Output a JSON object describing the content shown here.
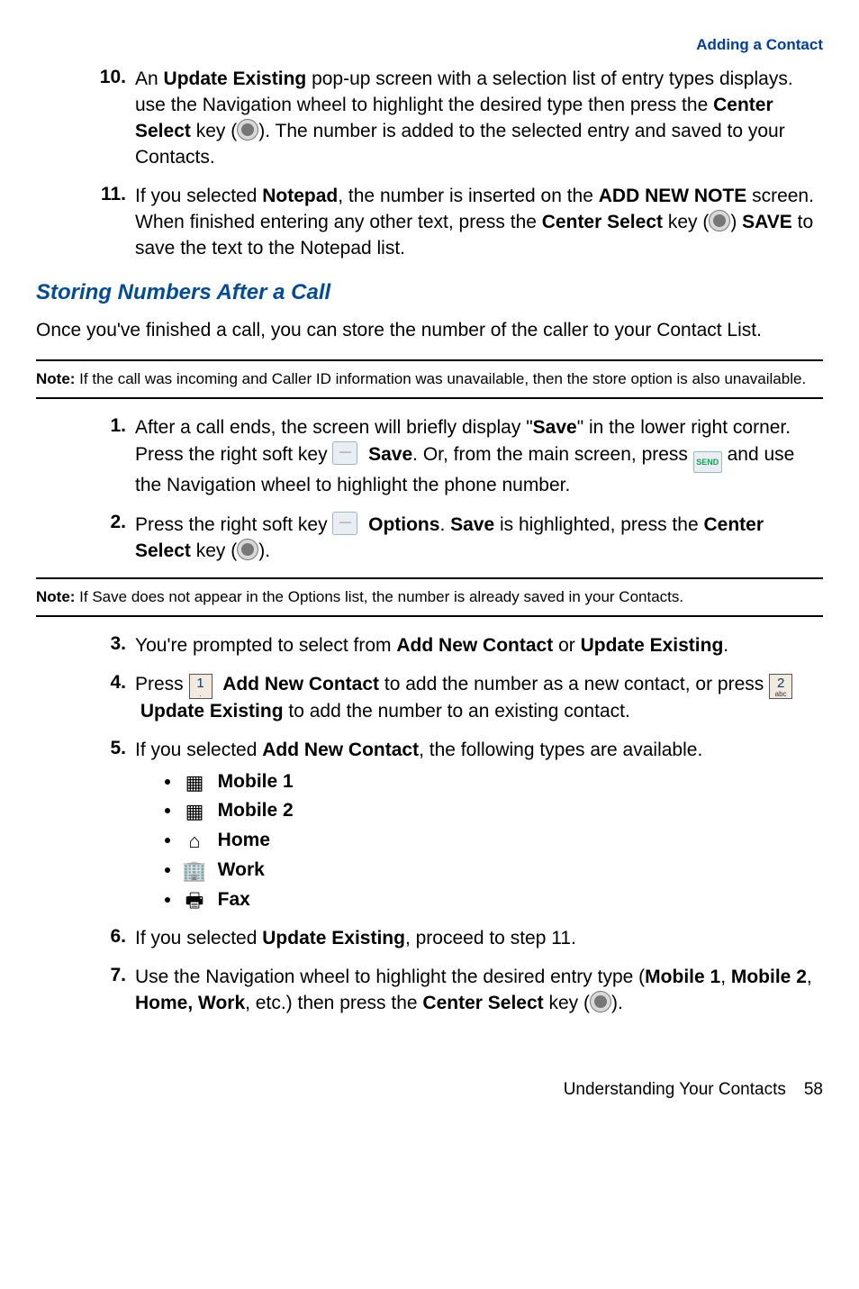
{
  "header": {
    "section_link": "Adding a Contact"
  },
  "steps_a": {
    "s10": {
      "num": "10.",
      "t1": "An ",
      "b1": "Update Existing",
      "t2": " pop-up screen with a selection list of entry types displays. use the Navigation wheel to highlight the desired type then press the ",
      "b2": "Center Select",
      "t3": " key (",
      "t4": "). The number is added to the selected entry and saved to your Contacts."
    },
    "s11": {
      "num": "11.",
      "t1": "If you selected ",
      "b1": "Notepad",
      "t2": ", the number is inserted on the ",
      "b2": "ADD NEW NOTE",
      "t3": " screen.  When finished entering any other text, press the ",
      "b3": "Center Select",
      "t4": " key (",
      "t5": ") ",
      "b4": "SAVE",
      "t6": " to save the text to the Notepad list."
    }
  },
  "section_title": "Storing Numbers After a Call",
  "intro_para": "Once you've finished a call, you can store the number of the caller to your Contact List.",
  "note1": {
    "label": "Note: ",
    "text": "If the call was incoming and Caller ID information was unavailable, then the store option is also unavailable."
  },
  "steps_b": {
    "s1": {
      "num": "1.",
      "t1": "After a call ends, the screen will briefly display \"",
      "b1": "Save",
      "t2": "\" in the lower right corner.  Press the right soft key ",
      "b2": "Save",
      "t3": ".  Or, from the main screen, press ",
      "t4": " and use the Navigation wheel to highlight the phone number."
    },
    "s2": {
      "num": "2.",
      "t1": "Press the right soft key ",
      "b1": "Options",
      "t2": ". ",
      "b2": "Save",
      "t3": " is highlighted, press the ",
      "b3": "Center Select",
      "t4": " key (",
      "t5": ")."
    }
  },
  "note2": {
    "label": "Note: ",
    "text": "If Save does not appear in the Options list, the number is already saved in your Contacts."
  },
  "steps_c": {
    "s3": {
      "num": "3.",
      "t1": "You're prompted to select from ",
      "b1": "Add New Contact",
      "t2": " or ",
      "b2": "Update Existing",
      "t3": "."
    },
    "s4": {
      "num": "4.",
      "t1": "Press ",
      "b1": "Add New Contact",
      "t2": " to add the number as a new contact, or press ",
      "b2": "Update Existing",
      "t3": " to add the number to an existing contact."
    },
    "s5": {
      "num": "5.",
      "t1": "If you selected ",
      "b1": "Add New Contact",
      "t2": ", the following types are available."
    },
    "types": {
      "m1": "Mobile 1",
      "m2": "Mobile 2",
      "home": "Home",
      "work": "Work",
      "fax": "Fax"
    },
    "s6": {
      "num": "6.",
      "t1": "If you selected ",
      "b1": "Update Existing",
      "t2": ", proceed to step 11."
    },
    "s7": {
      "num": "7.",
      "t1": "Use the Navigation wheel to highlight the desired entry type (",
      "b1": "Mobile 1",
      "t2": ", ",
      "b2": "Mobile 2",
      "t3": ", ",
      "b3": "Home, Work",
      "t4": ", etc.) then press the ",
      "b4": "Center Select",
      "t5": " key (",
      "t6": ")."
    }
  },
  "footer": {
    "chapter": "Understanding Your Contacts",
    "page": "58"
  },
  "key_labels": {
    "send": "SEND",
    "k1_sub": ".",
    "k2_sub": "abc"
  }
}
